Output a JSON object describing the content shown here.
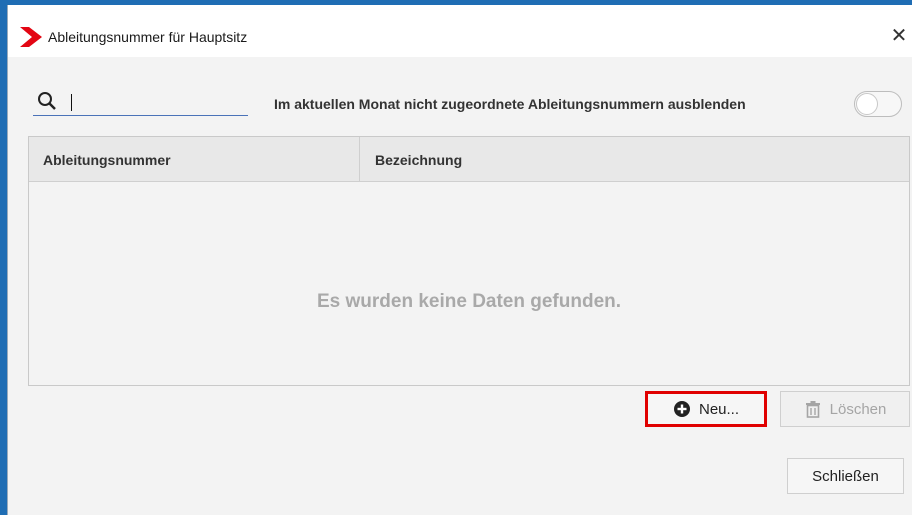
{
  "window": {
    "title": "Ableitungsnummer für Hauptsitz",
    "close_glyph": "✕",
    "logo_icon": "red-arrow-logo-icon",
    "accent_color": "#e30613"
  },
  "search": {
    "value": "",
    "placeholder": "",
    "icon": "search-icon"
  },
  "filter_toggle": {
    "label": "Im aktuellen Monat nicht zugeordnete Ableitungsnummern ausblenden",
    "on": false
  },
  "table": {
    "columns": [
      "Ableitungsnummer",
      "Bezeichnung"
    ],
    "rows": [],
    "empty_message": "Es wurden keine Daten gefunden."
  },
  "actions": {
    "new_label": "Neu...",
    "new_icon": "plus-circle-icon",
    "delete_label": "Löschen",
    "delete_icon": "trash-icon",
    "delete_enabled": false,
    "close_label": "Schließen",
    "highlight_color": "#e00000"
  }
}
